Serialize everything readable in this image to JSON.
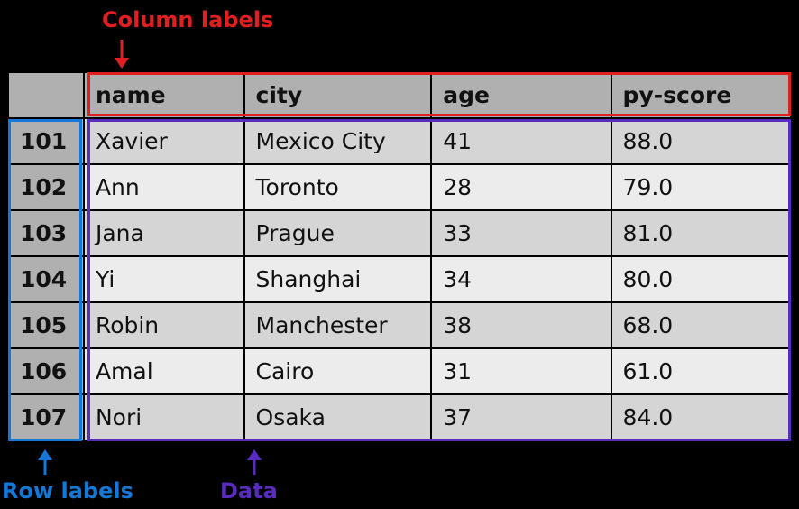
{
  "annotations": {
    "columns": "Column labels",
    "rows": "Row labels",
    "data": "Data"
  },
  "chart_data": {
    "type": "table",
    "columns": [
      "name",
      "city",
      "age",
      "py-score"
    ],
    "index": [
      "101",
      "102",
      "103",
      "104",
      "105",
      "106",
      "107"
    ],
    "rows": [
      {
        "name": "Xavier",
        "city": "Mexico City",
        "age": "41",
        "py-score": "88.0"
      },
      {
        "name": "Ann",
        "city": "Toronto",
        "age": "28",
        "py-score": "79.0"
      },
      {
        "name": "Jana",
        "city": "Prague",
        "age": "33",
        "py-score": "81.0"
      },
      {
        "name": "Yi",
        "city": "Shanghai",
        "age": "34",
        "py-score": "80.0"
      },
      {
        "name": "Robin",
        "city": "Manchester",
        "age": "38",
        "py-score": "68.0"
      },
      {
        "name": "Amal",
        "city": "Cairo",
        "age": "31",
        "py-score": "61.0"
      },
      {
        "name": "Nori",
        "city": "Osaka",
        "age": "37",
        "py-score": "84.0"
      }
    ]
  }
}
